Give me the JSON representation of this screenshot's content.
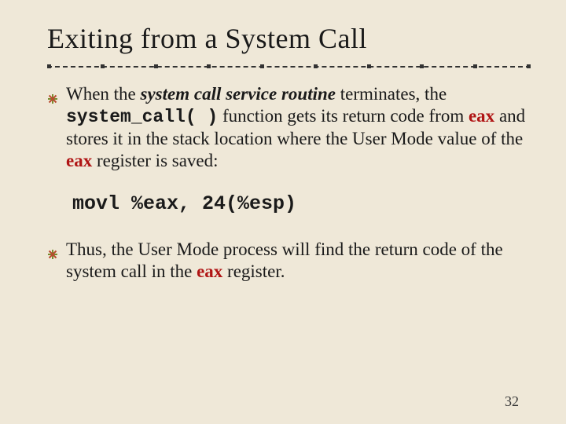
{
  "title": "Exiting from a System Call",
  "bullet1": {
    "p1": "When the ",
    "ital1": "system call service routine",
    "p2": " terminates, the ",
    "mono1": "system_call( )",
    "p3": " function gets its return code from ",
    "red1": "eax",
    "p4": " and stores it in the stack location where the User Mode value of the ",
    "red2": "eax",
    "p5": " register is saved:"
  },
  "code": "movl %eax, 24(%esp)",
  "bullet2": {
    "p1": "Thus, the User Mode process will find the return code of the system call in the ",
    "red1": "eax",
    "p2": " register."
  },
  "pagenum": "32"
}
